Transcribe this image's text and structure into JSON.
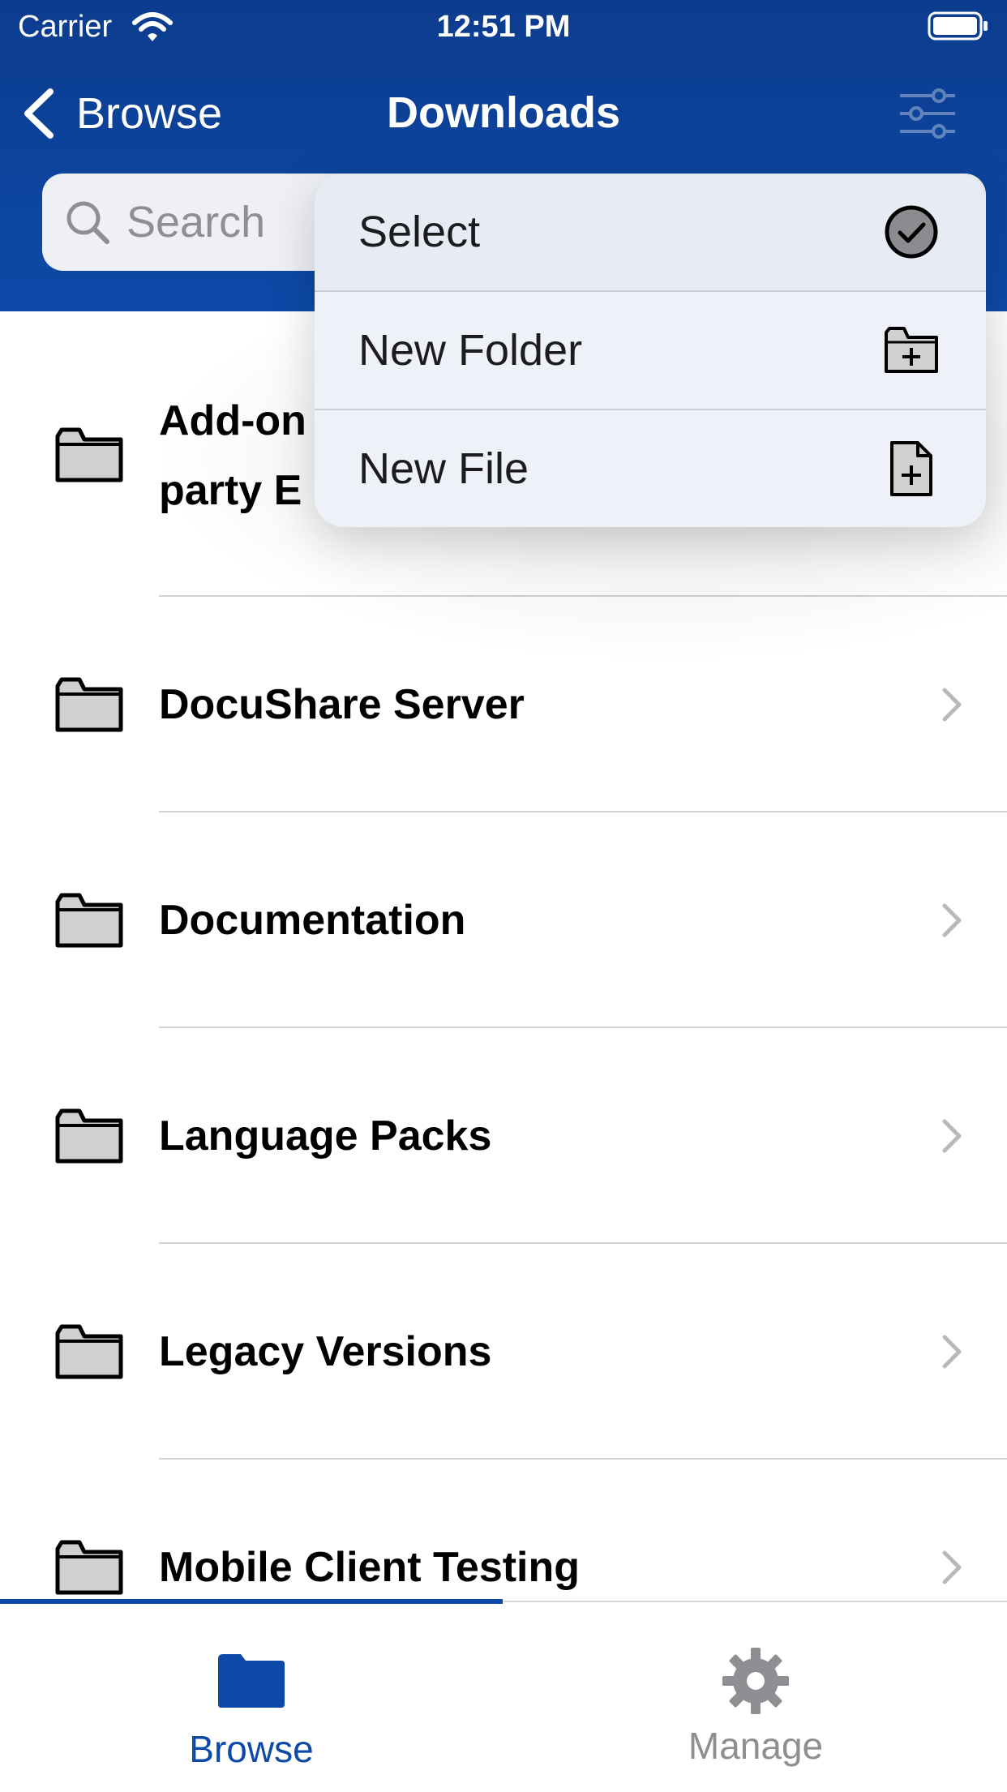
{
  "status_bar": {
    "carrier": "Carrier",
    "time": "12:51 PM"
  },
  "nav": {
    "back_label": "Browse",
    "title": "Downloads"
  },
  "search": {
    "placeholder": "Search"
  },
  "menu": {
    "items": [
      {
        "label": "Select",
        "icon": "checkmark-circle-icon"
      },
      {
        "label": "New Folder",
        "icon": "folder-plus-icon"
      },
      {
        "label": "New File",
        "icon": "document-plus-icon"
      }
    ]
  },
  "list": {
    "items": [
      {
        "label_line1": "Add-on",
        "label_line2": "party E",
        "icon": "folder-icon"
      },
      {
        "label": "DocuShare Server",
        "icon": "folder-icon"
      },
      {
        "label": "Documentation",
        "icon": "folder-icon"
      },
      {
        "label": "Language Packs",
        "icon": "folder-icon"
      },
      {
        "label": "Legacy Versions",
        "icon": "folder-icon"
      },
      {
        "label": "Mobile Client Testing",
        "icon": "folder-icon"
      }
    ]
  },
  "tabs": [
    {
      "label": "Browse",
      "icon": "folder-filled-icon",
      "selected": true
    },
    {
      "label": "Manage",
      "icon": "gear-icon",
      "selected": false
    }
  ],
  "colors": {
    "brand": "#0d4aa8",
    "tab_inactive": "#8e8e93"
  }
}
